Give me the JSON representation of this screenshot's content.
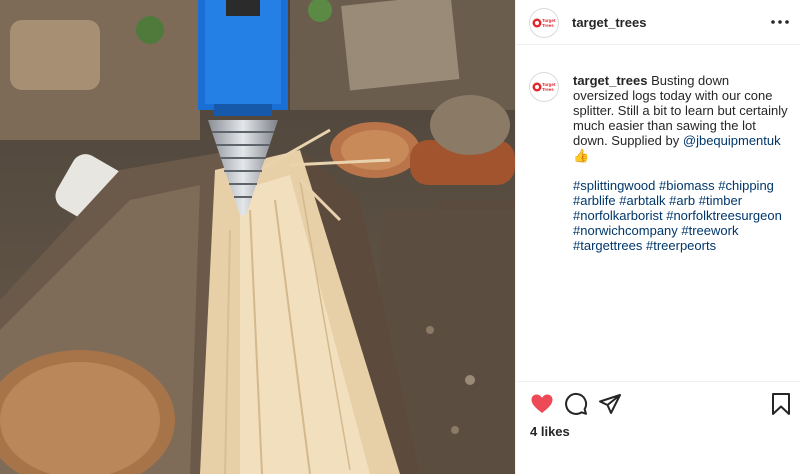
{
  "post": {
    "username": "target_trees",
    "avatar_text_line1": "Target",
    "avatar_text_line2": "Trees",
    "caption": {
      "username": "target_trees",
      "text": "Busting down oversized logs today with our cone splitter. Still a bit to learn but certainly much easier than sawing the lot down. Supplied by",
      "mention": "@jbequipmentuk",
      "emoji": "👍",
      "hashtags": "#splittingwood #biomass #chipping #arblife #arbtalk #arb #timber #norfolkarborist #norfolktreesurgeon #norwichcompany #treework #targettrees #treerpeorts"
    },
    "likes": "4 likes"
  },
  "icons": {
    "more": "more-dots-icon",
    "like": "heart-icon",
    "comment": "comment-icon",
    "share": "share-icon",
    "save": "bookmark-icon"
  },
  "colors": {
    "like": "#ed4956",
    "link": "#00376b",
    "text": "#262626",
    "avatar_red": "#e0282e",
    "machine_blue": "#1a6fd4"
  }
}
